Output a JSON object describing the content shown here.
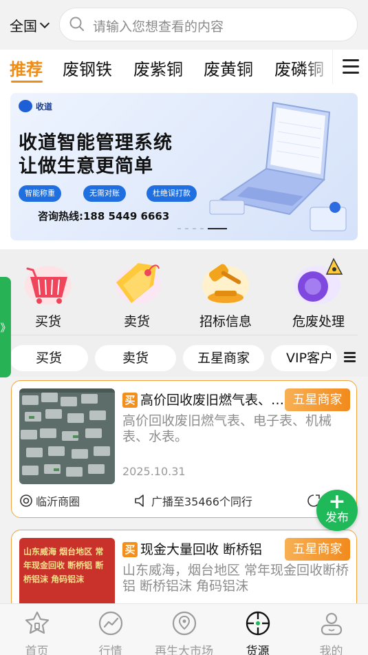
{
  "header": {
    "region": "全国",
    "search_placeholder": "请输入您想查看的内容"
  },
  "tabs": [
    "推荐",
    "废钢铁",
    "废紫铜",
    "废黄铜",
    "废磷铜"
  ],
  "active_tab": "推荐",
  "banner": {
    "logo_text": "收道",
    "headline_1": "收道智能管理系统",
    "headline_2": "让做生意更简单",
    "pills": [
      "智能称重",
      "无需对账",
      "杜绝误打款"
    ],
    "hotline": "咨询热线:188 5449 6663",
    "slide_count": 5,
    "active_slide": 5
  },
  "quick_links": [
    {
      "label": "买货",
      "icon": "shopping-basket-icon"
    },
    {
      "label": "卖货",
      "icon": "price-tag-icon"
    },
    {
      "label": "招标信息",
      "icon": "gavel-icon"
    },
    {
      "label": "危废处理",
      "icon": "hazard-barrel-icon"
    }
  ],
  "side_handle": "》",
  "filters": [
    "买货",
    "卖货",
    "五星商家",
    "VIP客户"
  ],
  "listings": [
    {
      "tag": "买",
      "title": "高价回收废旧燃气表、电子表、机械表、水表。",
      "badge": "五星商家",
      "desc": "高价回收废旧燃气表、电子表、机械表、水表。",
      "date": "2025.10.31",
      "circle": "临沂商圈",
      "broadcast": "广播至35466个同行"
    },
    {
      "tag": "买",
      "title": "现金大量回收 断桥铝",
      "badge": "五星商家",
      "desc": "山东威海，烟台地区 常年现金回收断桥铝 断桥铝沫 角码铝沫",
      "thumb_text": "山东威海 烟台地区 常年现金回收 断桥铝 断桥铝沫 角码铝沫"
    }
  ],
  "fab": {
    "label": "发布"
  },
  "bottom_nav": [
    {
      "label": "首页",
      "icon": "home-star-icon",
      "active": false
    },
    {
      "label": "行情",
      "icon": "trend-chart-icon",
      "active": false
    },
    {
      "label": "再生大市场",
      "icon": "map-pin-icon",
      "active": false
    },
    {
      "label": "货源",
      "icon": "crosshair-icon",
      "active": true
    },
    {
      "label": "我的",
      "icon": "user-icon",
      "active": false
    }
  ],
  "colors": {
    "accent": "#f08c14",
    "green": "#1fb95a",
    "banner_blue": "#1f6fe0"
  }
}
